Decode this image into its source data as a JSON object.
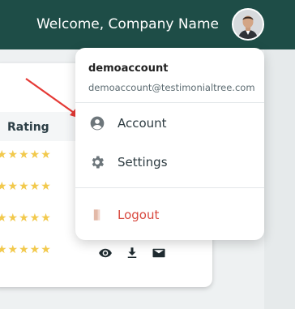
{
  "header": {
    "welcome_text": "Welcome, Company Name",
    "bg_color": "#1e4d47"
  },
  "table": {
    "rating_header": "Rating",
    "rows": [
      {
        "stars": "★★★★★"
      },
      {
        "stars": "★★★★★"
      },
      {
        "stars": "★★★★★"
      },
      {
        "stars": "★★★★★"
      }
    ],
    "actions": [
      "eye-icon",
      "download-icon",
      "mail-icon"
    ]
  },
  "dropdown": {
    "username": "demoaccount",
    "email": "demoaccount@testimonialtree.com",
    "items": [
      {
        "label": "Account",
        "icon": "account-circle-icon"
      },
      {
        "label": "Settings",
        "icon": "gear-icon"
      },
      {
        "label": "Logout",
        "icon": "logout-icon",
        "color": "#d8493f"
      }
    ]
  }
}
